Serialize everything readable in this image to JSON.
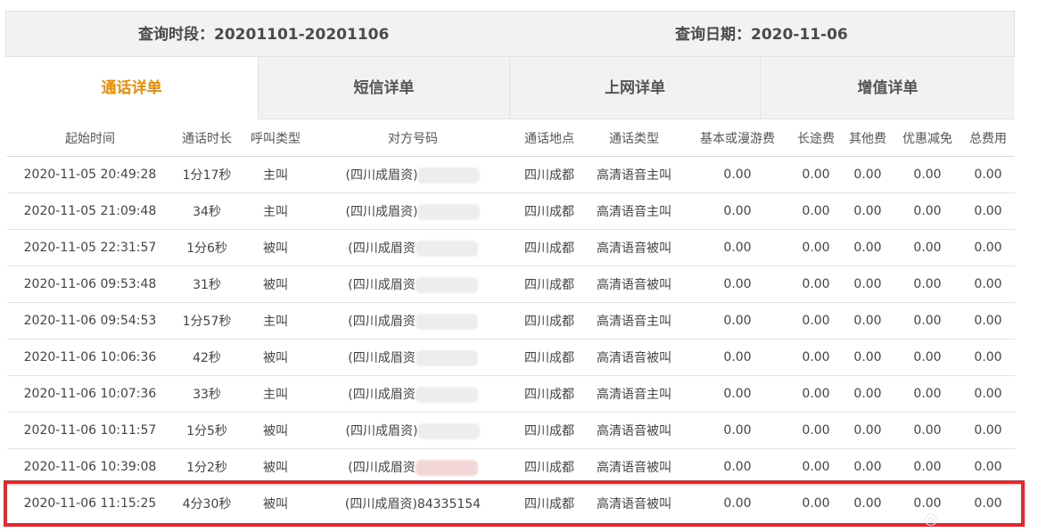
{
  "query": {
    "period_label": "查询时段：20201101-20201106",
    "date_label": "查询日期：2020-11-06"
  },
  "tabs": [
    {
      "label": "通话详单",
      "active": true
    },
    {
      "label": "短信详单",
      "active": false
    },
    {
      "label": "上网详单",
      "active": false
    },
    {
      "label": "增值详单",
      "active": false
    }
  ],
  "columns": [
    "起始时间",
    "通话时长",
    "呼叫类型",
    "对方号码",
    "通话地点",
    "通话类型",
    "基本或漫游费",
    "长途费",
    "其他费",
    "优惠减免",
    "总费用"
  ],
  "rows": [
    {
      "start": "2020-11-05 20:49:28",
      "duration": "1分17秒",
      "call_type": "主叫",
      "number": "(四川成眉资)",
      "location": "四川成都",
      "service": "高清语音主叫",
      "base_fee": "0.00",
      "ld_fee": "0.00",
      "other_fee": "0.00",
      "discount": "0.00",
      "total": "0.00"
    },
    {
      "start": "2020-11-05 21:09:48",
      "duration": "34秒",
      "call_type": "主叫",
      "number": "(四川成眉资)",
      "location": "四川成都",
      "service": "高清语音主叫",
      "base_fee": "0.00",
      "ld_fee": "0.00",
      "other_fee": "0.00",
      "discount": "0.00",
      "total": "0.00"
    },
    {
      "start": "2020-11-05 22:31:57",
      "duration": "1分6秒",
      "call_type": "被叫",
      "number": "(四川成眉资",
      "location": "四川成都",
      "service": "高清语音被叫",
      "base_fee": "0.00",
      "ld_fee": "0.00",
      "other_fee": "0.00",
      "discount": "0.00",
      "total": "0.00"
    },
    {
      "start": "2020-11-06 09:53:48",
      "duration": "31秒",
      "call_type": "被叫",
      "number": "(四川成眉资",
      "location": "四川成都",
      "service": "高清语音被叫",
      "base_fee": "0.00",
      "ld_fee": "0.00",
      "other_fee": "0.00",
      "discount": "0.00",
      "total": "0.00"
    },
    {
      "start": "2020-11-06 09:54:53",
      "duration": "1分57秒",
      "call_type": "主叫",
      "number": "(四川成眉资",
      "location": "四川成都",
      "service": "高清语音主叫",
      "base_fee": "0.00",
      "ld_fee": "0.00",
      "other_fee": "0.00",
      "discount": "0.00",
      "total": "0.00"
    },
    {
      "start": "2020-11-06 10:06:36",
      "duration": "42秒",
      "call_type": "被叫",
      "number": "(四川成眉资",
      "location": "四川成都",
      "service": "高清语音被叫",
      "base_fee": "0.00",
      "ld_fee": "0.00",
      "other_fee": "0.00",
      "discount": "0.00",
      "total": "0.00"
    },
    {
      "start": "2020-11-06 10:07:36",
      "duration": "33秒",
      "call_type": "主叫",
      "number": "(四川成眉资",
      "location": "四川成都",
      "service": "高清语音主叫",
      "base_fee": "0.00",
      "ld_fee": "0.00",
      "other_fee": "0.00",
      "discount": "0.00",
      "total": "0.00"
    },
    {
      "start": "2020-11-06 10:11:57",
      "duration": "1分5秒",
      "call_type": "被叫",
      "number": "(四川成眉资)",
      "location": "四川成都",
      "service": "高清语音被叫",
      "base_fee": "0.00",
      "ld_fee": "0.00",
      "other_fee": "0.00",
      "discount": "0.00",
      "total": "0.00"
    },
    {
      "start": "2020-11-06 10:39:08",
      "duration": "1分2秒",
      "call_type": "被叫",
      "number": "(四川成眉资",
      "location": "四川成都",
      "service": "高清语音被叫",
      "base_fee": "0.00",
      "ld_fee": "0.00",
      "other_fee": "0.00",
      "discount": "0.00",
      "total": "0.00"
    },
    {
      "start": "2020-11-06 11:15:25",
      "duration": "4分30秒",
      "call_type": "被叫",
      "number": "(四川成眉资)84335154",
      "location": "四川成都",
      "service": "高清语音被叫",
      "base_fee": "0.00",
      "ld_fee": "0.00",
      "other_fee": "0.00",
      "discount": "0.00",
      "total": "0.00",
      "highlighted": true
    }
  ],
  "highlight_color": "#e8272d",
  "accent_color": "#f08a00"
}
